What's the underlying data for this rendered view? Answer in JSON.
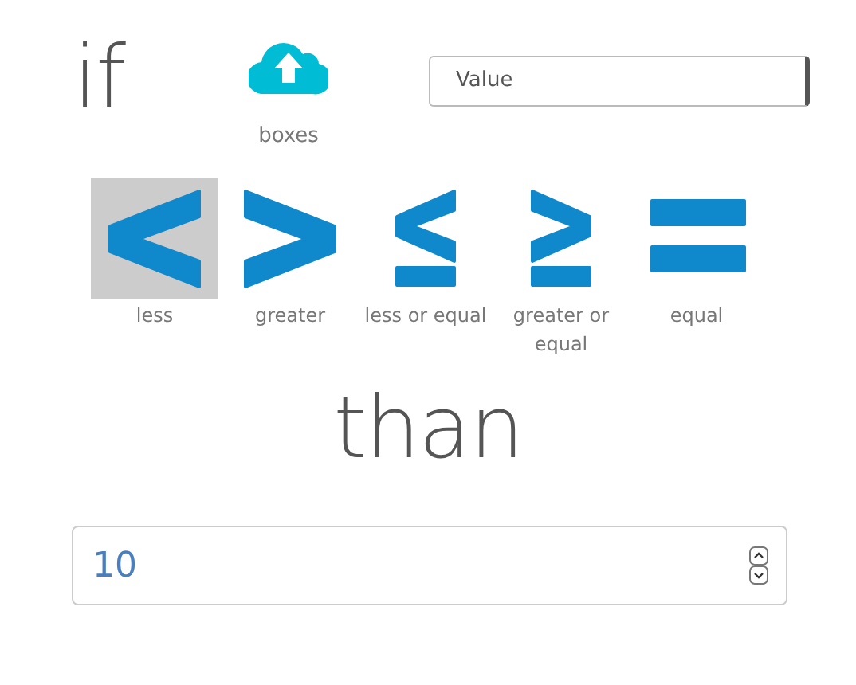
{
  "condition": {
    "keyword": "if"
  },
  "source": {
    "label": "boxes"
  },
  "field_select": {
    "value": "Value"
  },
  "operators": [
    {
      "kind": "less",
      "label": "less",
      "selected": true
    },
    {
      "kind": "greater",
      "label": "greater",
      "selected": false
    },
    {
      "kind": "less_equal",
      "label": "less or equal",
      "selected": false
    },
    {
      "kind": "greater_equal",
      "label": "greater or equal",
      "selected": false
    },
    {
      "kind": "equal",
      "label": "equal",
      "selected": false
    }
  ],
  "comparison_word": "than",
  "number_input": {
    "value": "10"
  }
}
